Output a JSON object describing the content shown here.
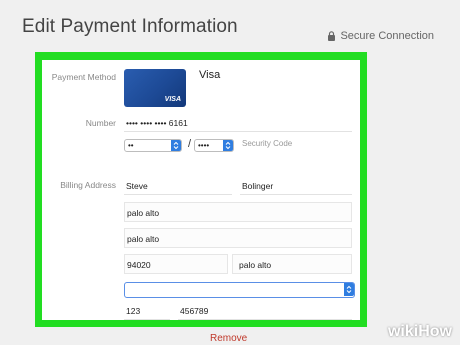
{
  "header": {
    "title": "Edit Payment Information",
    "secure_label": "Secure Connection"
  },
  "payment": {
    "method_label": "Payment Method",
    "card_brand": "Visa",
    "card_logo_text": "VISA",
    "number_label": "Number",
    "number_value": "•••• •••• •••• 6161",
    "exp_month": "••",
    "exp_year": "••••",
    "slash": "/",
    "security_placeholder": "Security Code"
  },
  "billing": {
    "label": "Billing Address",
    "first_name": "Steve",
    "last_name": "Bolinger",
    "address1": "palo alto",
    "address2": "palo alto",
    "zip": "94020",
    "city": "palo alto",
    "country": "",
    "area_code": "123",
    "phone": "456789"
  },
  "actions": {
    "remove_label": "Remove"
  },
  "watermark": {
    "part1": "wiki",
    "part2": "How"
  },
  "colors": {
    "highlight": "#22dd22",
    "card": "#1d4a96",
    "select_button": "#2f7de0",
    "remove": "#c0392b"
  }
}
